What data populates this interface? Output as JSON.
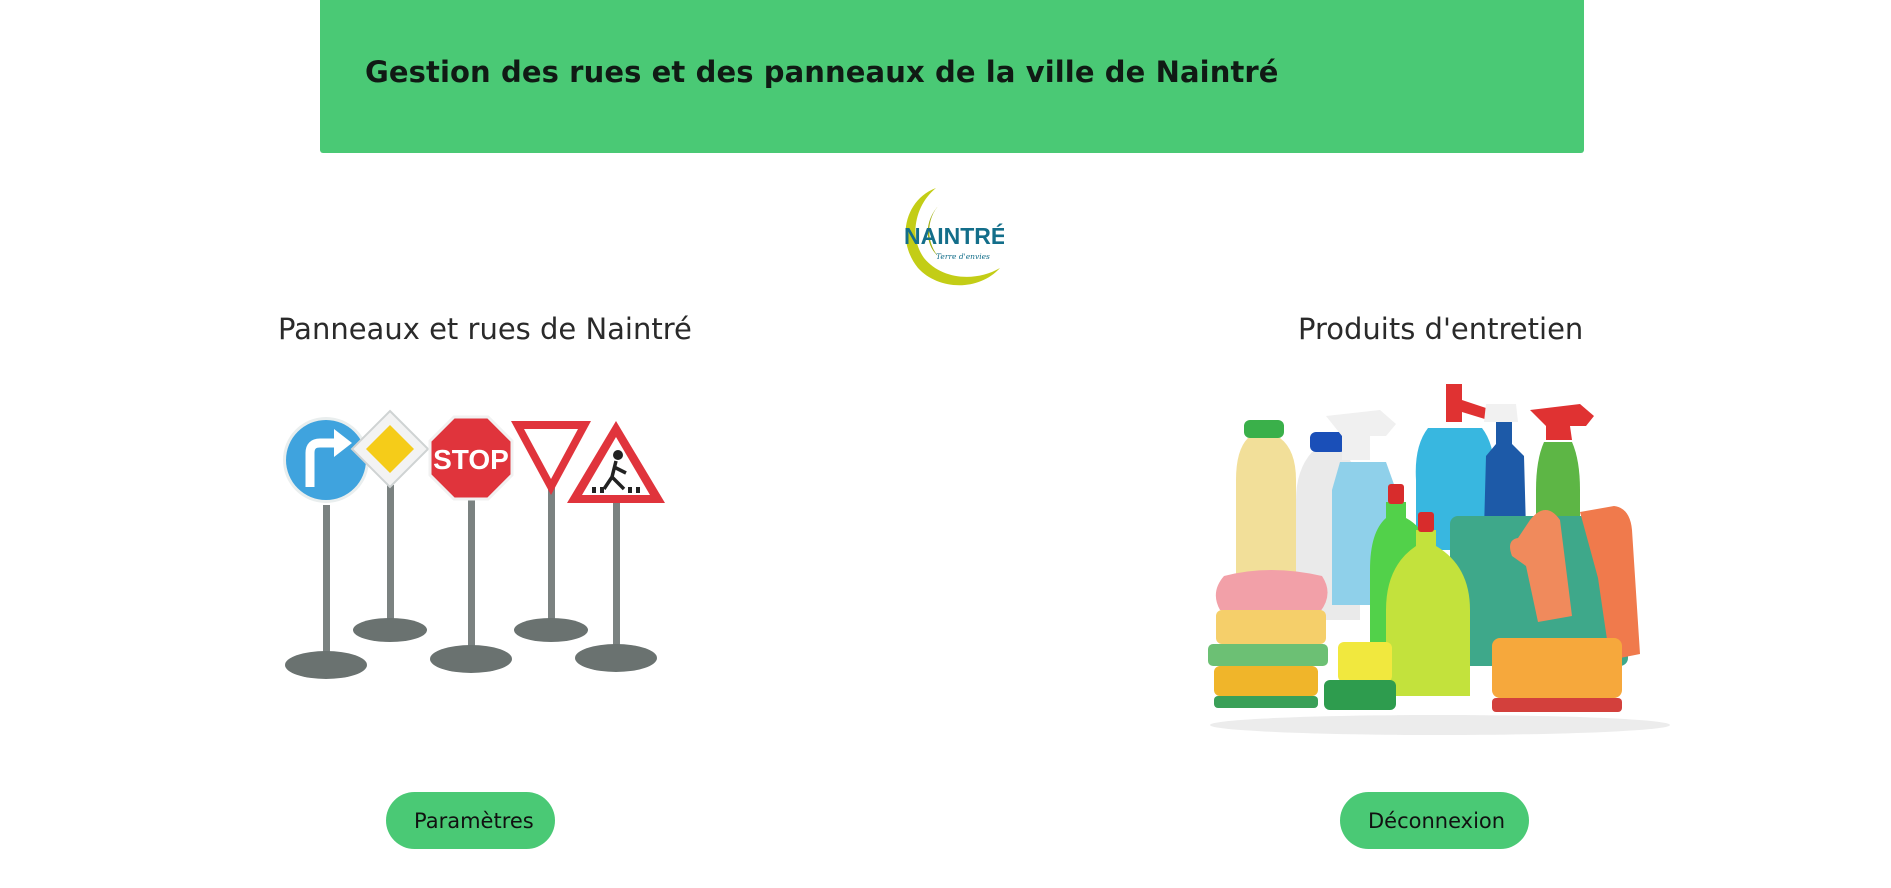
{
  "header": {
    "title": "Gestion des rues et des panneaux de la ville de Naintré",
    "background_color": "#4ac975"
  },
  "logo": {
    "text": "NAINTRÉ",
    "tagline": "Terre d'envies",
    "icon": "naintre-logo"
  },
  "sections": [
    {
      "title": "Panneaux et rues de Naintré",
      "image": "road-signs-image",
      "button_label": "Paramètres"
    },
    {
      "title": "Produits d'entretien",
      "image": "cleaning-products-image",
      "button_label": "Déconnexion"
    }
  ],
  "colors": {
    "accent": "#4ac975",
    "text_dark": "#101a14"
  }
}
